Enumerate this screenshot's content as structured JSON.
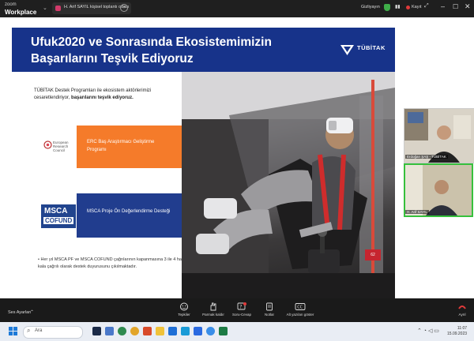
{
  "window": {
    "app_small": "zoom",
    "app_big": "Workplace",
    "meeting_tab": "H. Arif SAYIL kişisel toplantı odası",
    "privacy_label": "Gizliyayın",
    "recording_label": "Kayıt",
    "chevron": "⌄"
  },
  "slide": {
    "title_line1": "Ufuk2020 ve Sonrasında Ekosistemimizin",
    "title_line2": "Başarılarını Teşvik Ediyoruz",
    "brand": "TÜBİTAK",
    "intro_plain": "TÜBİTAK Destek Programları ile ekosistem aktörlerimizi cesaretlendiriyor, ",
    "intro_bold": "başarılarını teşvik ediyoruz.",
    "erc_logo_text": "European Research Council",
    "erc_box": "ERC Baş Araştırmacı Geliştirme Programı",
    "msca_logo_line1": "MSCA",
    "msca_logo_line2": "COFUND",
    "msca_box": "MSCA Proje Ön Değerlendirme Desteği",
    "bullet": "Her yıl MSCA PF ve MSCA COFUND çağrılarının kapanmasına 3 ile 4 hafta kala çağrılı olarak destek duyurusunu çıkılmaktadır.",
    "page_badge": "62"
  },
  "participants": [
    {
      "name": "Erdoğan ŞAŞ - TÜBİTAK"
    },
    {
      "name": "H. Arif SAYIL"
    }
  ],
  "controls": {
    "audio_settings": "Ses Ayarları",
    "reactions": "Tepkiler",
    "raise_hand": "Parmak kaldır",
    "qa": "Soru-Cevap",
    "notes": "Notlar",
    "captions": "Alt yazıları göster",
    "leave": "Ayrıl"
  },
  "taskbar": {
    "search": "Ara",
    "time": "11:07",
    "date": "15.09.2023"
  },
  "colors": {
    "slide_header": "#17338a",
    "erc_orange": "#f57b2a",
    "msca_blue": "#213d8e",
    "active_speaker": "#36c03c"
  }
}
